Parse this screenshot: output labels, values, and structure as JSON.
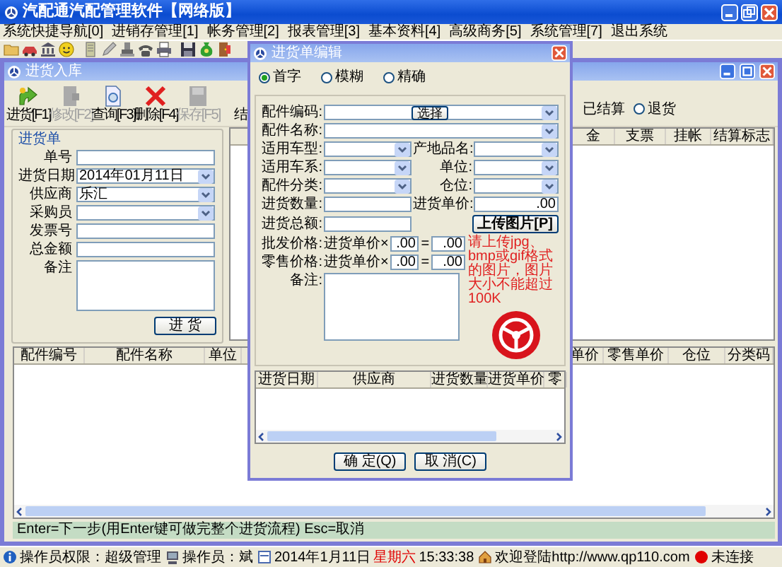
{
  "app": {
    "title": "汽配通汽配管理软件【网络版】"
  },
  "menu": [
    "系统快捷导航[0]",
    "进销存管理[1]",
    "帐务管理[2]",
    "报表管理[3]",
    "基本资料[4]",
    "高级商务[5]",
    "系统管理[7]",
    "退出系统"
  ],
  "entry_window": {
    "title": "进货入库",
    "toolbar": [
      {
        "label": "进货[F1]",
        "kind": "add",
        "disabled": false
      },
      {
        "label": "修改[F2]",
        "kind": "edit",
        "disabled": true
      },
      {
        "label": "查询[F3]",
        "kind": "query",
        "disabled": false
      },
      {
        "label": "删除[F4]",
        "kind": "delete",
        "disabled": false
      },
      {
        "label": "保存[F5]",
        "kind": "save",
        "disabled": true
      },
      {
        "label": "结",
        "kind": "plain",
        "disabled": false
      }
    ],
    "filters": [
      {
        "label": "已结算",
        "kind": "text"
      },
      {
        "label": "退货",
        "kind": "radio",
        "selected": false
      }
    ],
    "form": {
      "title": "进货单",
      "fields": [
        {
          "label": "单号",
          "kind": "input"
        },
        {
          "label": "进货日期",
          "kind": "combo",
          "value": "2014年01月11日"
        },
        {
          "label": "供应商",
          "kind": "combo",
          "value": "乐汇"
        },
        {
          "label": "采购员",
          "kind": "combo"
        },
        {
          "label": "发票号",
          "kind": "input"
        },
        {
          "label": "总金额",
          "kind": "input"
        },
        {
          "label": "备注",
          "kind": "textarea"
        }
      ],
      "submit": "进 货"
    },
    "summary_columns": [
      "金",
      "支票",
      "挂帐",
      "结算标志"
    ],
    "item_columns_left": [
      "配件编号",
      "配件名称",
      "单位"
    ],
    "item_columns_right": [
      "单价",
      "零售单价",
      "仓位",
      "分类码"
    ],
    "hint": "Enter=下一步(用Enter键可做完整个进货流程) Esc=取消"
  },
  "edit_dialog": {
    "title": "进货单编辑",
    "search_modes": [
      {
        "label": "首字",
        "selected": true
      },
      {
        "label": "模糊",
        "selected": false
      },
      {
        "label": "精确",
        "selected": false
      }
    ],
    "fields": [
      {
        "label": "配件编码:",
        "kind": "combo"
      },
      {
        "label": "配件名称:",
        "kind": "combo"
      },
      {
        "label": "适用车型:",
        "kind": "combo"
      },
      {
        "label": "产地品名:",
        "kind": "combo"
      },
      {
        "label": "适用车系:",
        "kind": "combo"
      },
      {
        "label": "单位:",
        "kind": "combo"
      },
      {
        "label": "配件分类:",
        "kind": "combo"
      },
      {
        "label": "仓位:",
        "kind": "combo"
      },
      {
        "label": "进货数量:",
        "kind": "input"
      },
      {
        "label": "进货单价:",
        "kind": "input",
        "value": ".00"
      },
      {
        "label": "进货总额:",
        "kind": "input"
      }
    ],
    "select_button": "选择",
    "upload_button": "上传图片[P]",
    "price_rows": [
      {
        "label": "批发价格:",
        "basis": "进货单价×",
        "factor": ".00",
        "equals": "=",
        "result": ".00"
      },
      {
        "label": "零售价格:",
        "basis": "进货单价×",
        "factor": ".00",
        "equals": "=",
        "result": ".00"
      }
    ],
    "upload_note": "请上传jpg、bmp或gif格式的图片，图片大小不能超过100K",
    "remark_label": "备注:",
    "grid_columns": [
      "进货日期",
      "供应商",
      "进货数量",
      "进货单价",
      "零"
    ],
    "buttons": [
      "确 定(Q)",
      "取 消(C)"
    ]
  },
  "status_bar": {
    "permission": "操作员权限：超级管理",
    "operator": "操作员：斌",
    "date": "2014年1月11日",
    "weekday": "星期六",
    "time": "15:33:38",
    "welcome": "欢迎登陆http://www.qp110.com",
    "connection": "未连接"
  }
}
